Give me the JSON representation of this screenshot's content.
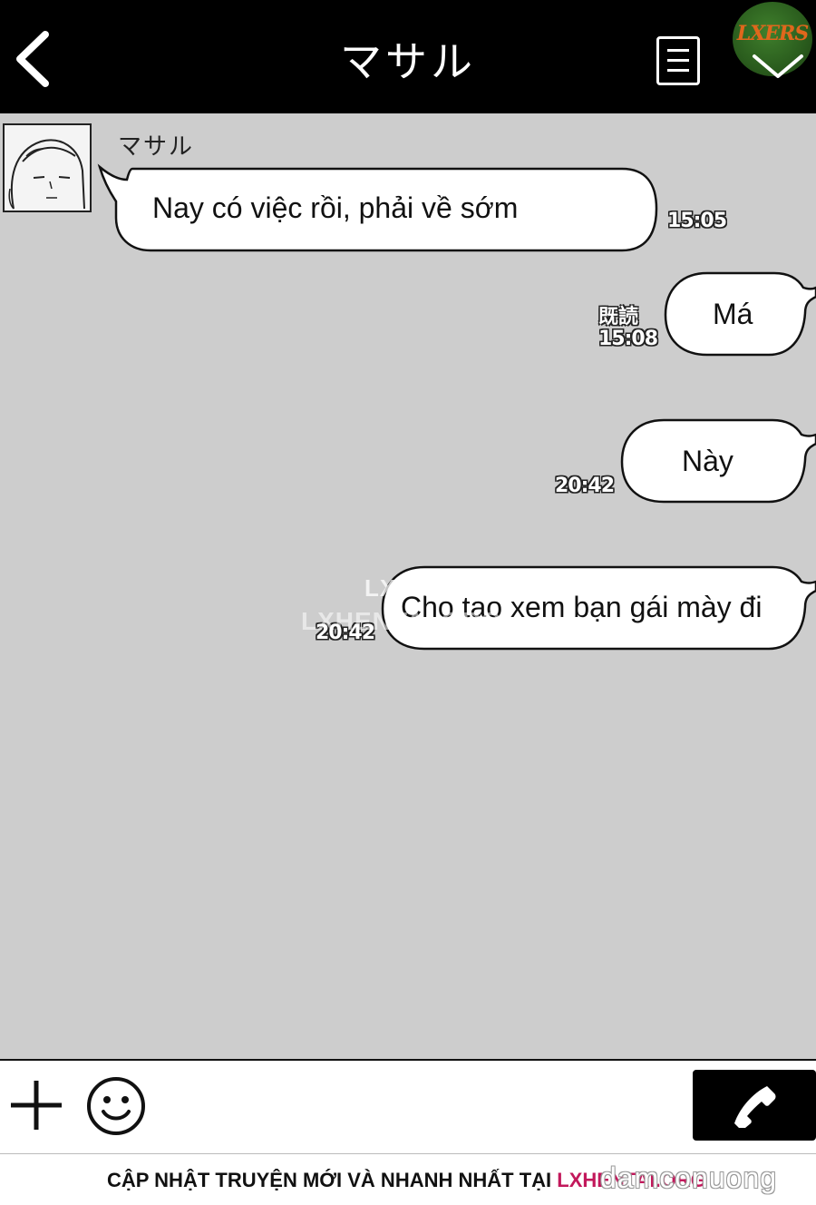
{
  "header": {
    "title": "マサル",
    "back_icon": "chevron-left-icon",
    "menu_icon": "list-icon",
    "logo_text": "LXERS",
    "colors": {
      "bar": "#000000",
      "text": "#ffffff"
    }
  },
  "chat": {
    "background": "#cdcdcd",
    "messages": [
      {
        "sender": "マサル",
        "direction": "incoming",
        "text": "Nay có việc rồi, phải về sớm",
        "time": "15:05",
        "read": ""
      },
      {
        "sender": "",
        "direction": "outgoing",
        "text": "Má",
        "time": "15:08",
        "read": "既読"
      },
      {
        "sender": "",
        "direction": "outgoing",
        "text": "Này",
        "time": "20:42",
        "read": ""
      },
      {
        "sender": "",
        "direction": "outgoing",
        "text": "Cho tao xem bạn gái mày đi",
        "time": "20:42",
        "read": ""
      }
    ],
    "watermark_line1": "LXERS",
    "watermark_line2": "LXHENTAI.ORG"
  },
  "input_bar": {
    "plus_icon": "plus-icon",
    "emoji_icon": "smiley-icon",
    "call_icon": "phone-icon"
  },
  "footer": {
    "text": "CẬP NHẬT TRUYỆN MỚI VÀ NHANH NHẤT TẠI ",
    "link": "LXHENTAI.ORG",
    "overlay_mark": "damconuong"
  }
}
